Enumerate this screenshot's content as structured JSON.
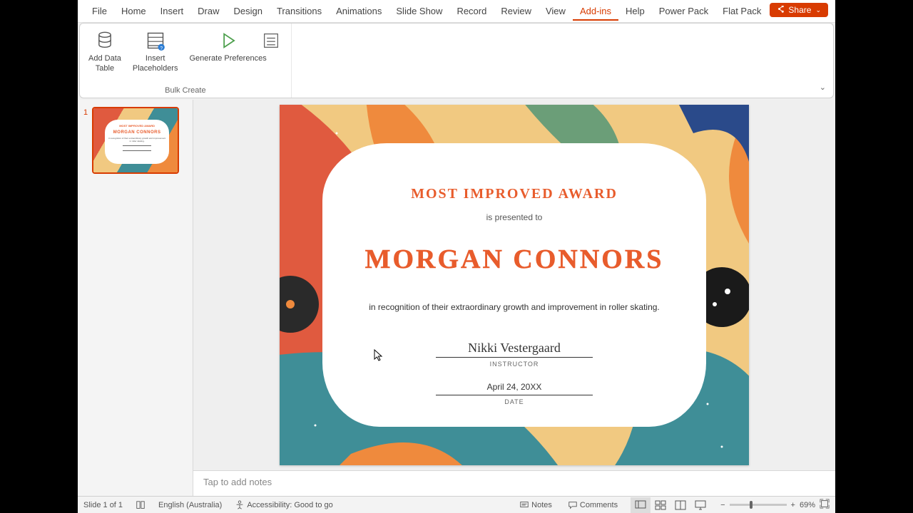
{
  "tabs": [
    "File",
    "Home",
    "Insert",
    "Draw",
    "Design",
    "Transitions",
    "Animations",
    "Slide Show",
    "Record",
    "Review",
    "View",
    "Add-ins",
    "Help",
    "Power Pack",
    "Flat Pack"
  ],
  "active_tab": "Add-ins",
  "share_label": "Share",
  "ribbon": {
    "buttons": {
      "add_data_table": "Add Data\nTable",
      "insert_placeholders": "Insert\nPlaceholders",
      "generate_preferences": "Generate Preferences"
    },
    "group_label": "Bulk Create"
  },
  "thumb": {
    "number": "1"
  },
  "certificate": {
    "title": "MOST IMPROVED AWARD",
    "presented": "is presented to",
    "recipient": "MORGAN CONNORS",
    "recognition": "in recognition of their extraordinary growth and improvement in roller skating.",
    "signature": "Nikki Vestergaard",
    "sig_label": "INSTRUCTOR",
    "date_value": "April 24, 20XX",
    "date_label": "DATE"
  },
  "notes_placeholder": "Tap to add notes",
  "status": {
    "slide": "Slide 1 of 1",
    "lang": "English (Australia)",
    "accessibility": "Accessibility: Good to go",
    "notes_btn": "Notes",
    "comments_btn": "Comments",
    "zoom": "69%"
  },
  "colors": {
    "accent": "#d83b01",
    "cert_orange": "#e85c2c",
    "bg_teal": "#3f8e97",
    "bg_sand": "#f1c981",
    "bg_green": "#6b9e78",
    "bg_red": "#e05a3f"
  }
}
